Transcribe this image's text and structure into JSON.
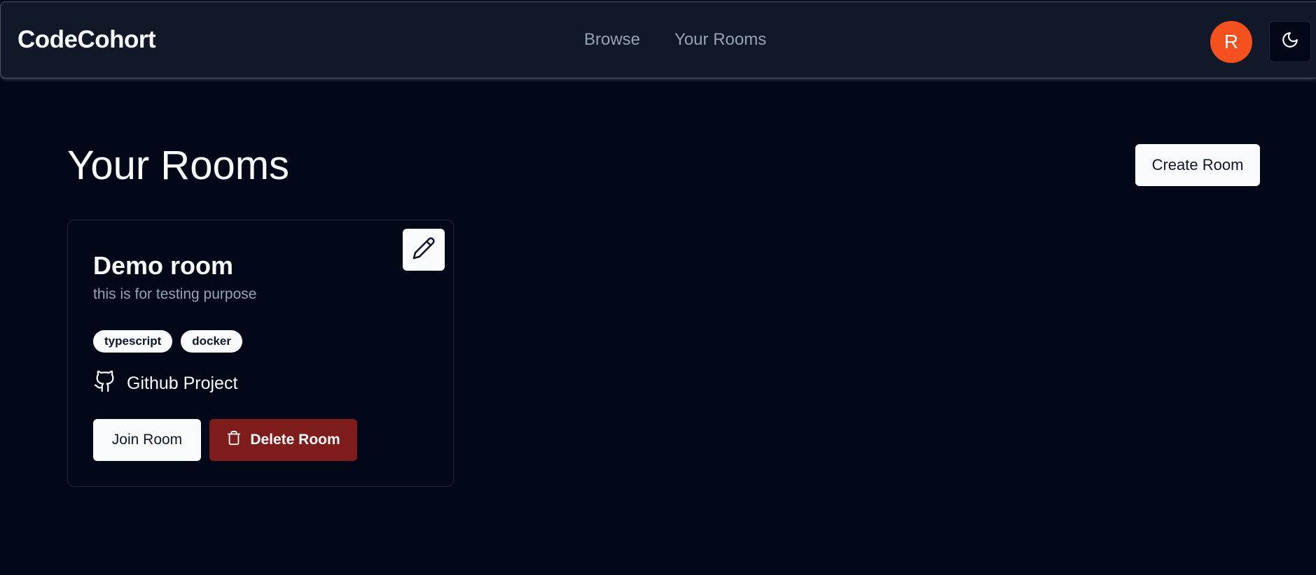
{
  "header": {
    "brand": "CodeCohort",
    "nav": [
      {
        "label": "Browse"
      },
      {
        "label": "Your Rooms"
      }
    ],
    "avatar_initial": "R",
    "theme_toggle_icon": "moon-icon"
  },
  "main": {
    "title": "Your Rooms",
    "create_button": "Create Room"
  },
  "rooms": [
    {
      "name": "Demo room",
      "description": "this is for testing purpose",
      "tags": [
        "typescript",
        "docker"
      ],
      "github_label": "Github Project",
      "join_label": "Join Room",
      "delete_label": "Delete Room",
      "edit_icon": "pencil-icon"
    }
  ],
  "colors": {
    "background": "#020817",
    "header": "#111827",
    "avatar": "#f4511e",
    "delete": "#7f1d1d",
    "muted_text": "#94a3b8"
  }
}
